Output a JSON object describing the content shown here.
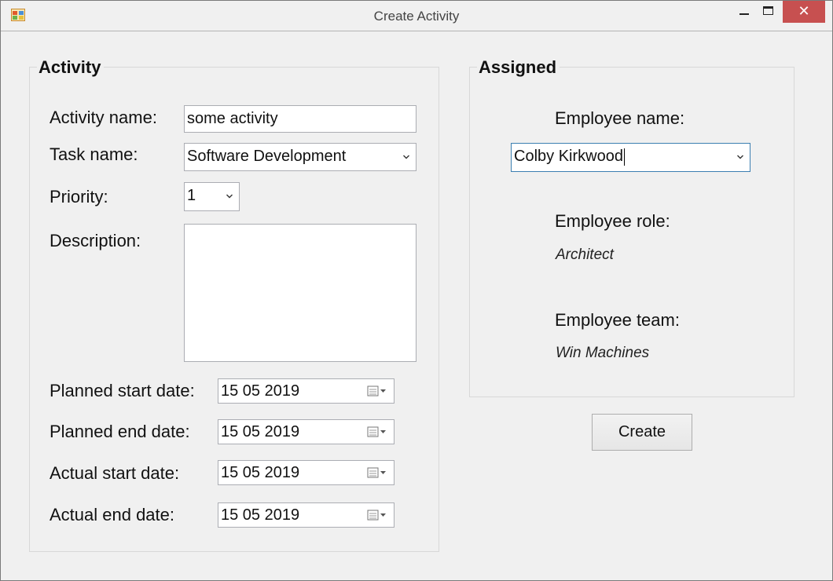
{
  "window": {
    "title": "Create Activity",
    "close_glyph": "✕"
  },
  "activity": {
    "group_title": "Activity",
    "activity_name_label": "Activity name:",
    "activity_name_value": "some activity",
    "task_name_label": "Task name:",
    "task_name_value": "Software Development",
    "priority_label": "Priority:",
    "priority_value": "1",
    "description_label": "Description:",
    "description_value": "",
    "planned_start_label": "Planned start date:",
    "planned_start_value": "15 05 2019",
    "planned_end_label": "Planned end date:",
    "planned_end_value": "15 05 2019",
    "actual_start_label": "Actual start date:",
    "actual_start_value": "15 05 2019",
    "actual_end_label": "Actual end date:",
    "actual_end_value": "15 05 2019"
  },
  "assigned": {
    "group_title": "Assigned",
    "employee_name_label": "Employee name:",
    "employee_name_value": "Colby Kirkwood",
    "employee_role_label": "Employee role:",
    "employee_role_value": "Architect",
    "employee_team_label": "Employee team:",
    "employee_team_value": "Win Machines"
  },
  "actions": {
    "create_label": "Create"
  },
  "icons": {
    "app": "app-form-icon",
    "minimize": "minimize-icon",
    "maximize": "maximize-icon",
    "close": "close-icon",
    "dropdown": "chevron-down-icon",
    "calendar": "calendar-dropdown-icon"
  },
  "colors": {
    "close_button": "#c75050",
    "focus_border": "#3c7fb1",
    "window_background": "#f0f0f0"
  }
}
